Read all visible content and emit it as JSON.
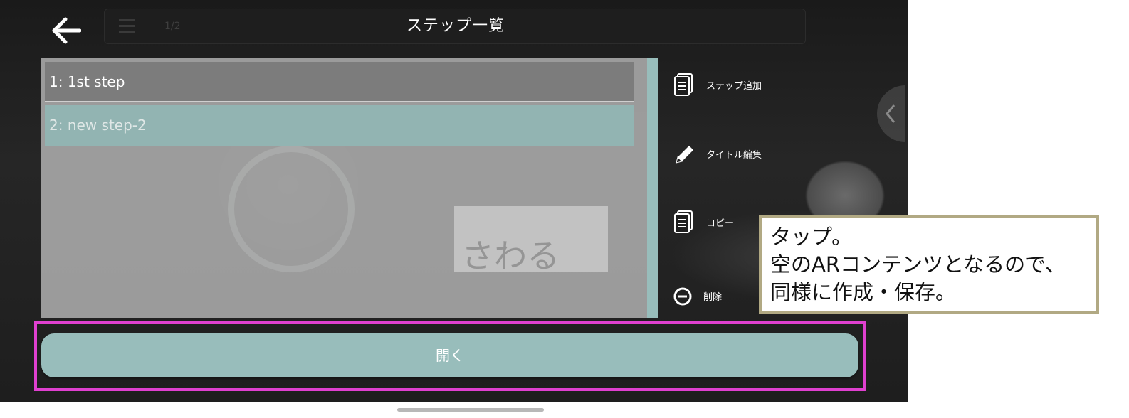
{
  "header": {
    "back_icon": "arrow-left-icon",
    "title": "ステップ一覧",
    "page_indicator": "1/2"
  },
  "steps": [
    {
      "label": "1: 1st step",
      "selected": true
    },
    {
      "label": "2: new step-2",
      "selected": false
    }
  ],
  "background_text": "さわる",
  "actions": {
    "add": {
      "label": "ステップ追加",
      "icon": "document-add-icon"
    },
    "edit_title": {
      "label": "タイトル編集",
      "icon": "pencil-icon"
    },
    "copy": {
      "label": "コピー",
      "icon": "copy-document-icon"
    },
    "delete": {
      "label": "削除",
      "icon": "minus-circle-icon"
    }
  },
  "open_button": {
    "label": "開く"
  },
  "callout": {
    "lines": [
      "タップ。",
      "空のARコンテンツとなるので、",
      "同様に作成・保存。"
    ]
  },
  "colors": {
    "accent_teal": "#98bdbb",
    "highlight_magenta": "#e040d0",
    "callout_border": "#b1a983"
  }
}
